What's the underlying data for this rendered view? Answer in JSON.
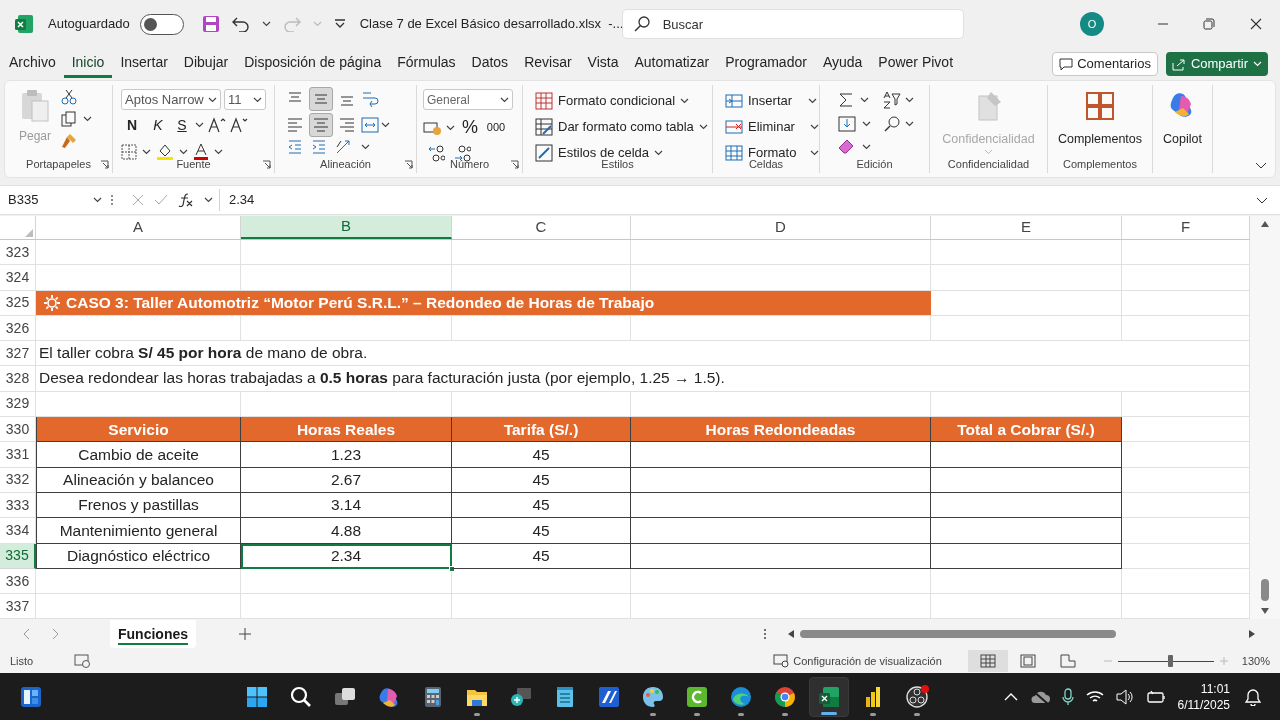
{
  "title_bar": {
    "autosave_label": "Autoguardado",
    "autosave_on": false,
    "filename": "Clase 7 de Excel Básico desarrollado.xlsx  -...",
    "search_placeholder": "Buscar",
    "avatar": "O"
  },
  "menu_tabs": [
    {
      "label": "Archivo",
      "selected": false
    },
    {
      "label": "Inicio",
      "selected": true
    },
    {
      "label": "Insertar",
      "selected": false
    },
    {
      "label": "Dibujar",
      "selected": false
    },
    {
      "label": "Disposición de página",
      "selected": false
    },
    {
      "label": "Fórmulas",
      "selected": false
    },
    {
      "label": "Datos",
      "selected": false
    },
    {
      "label": "Revisar",
      "selected": false
    },
    {
      "label": "Vista",
      "selected": false
    },
    {
      "label": "Automatizar",
      "selected": false
    },
    {
      "label": "Programador",
      "selected": false
    },
    {
      "label": "Ayuda",
      "selected": false
    },
    {
      "label": "Power Pivot",
      "selected": false
    }
  ],
  "comments_button": "Comentarios",
  "share_button": "Compartir",
  "ribbon_groups": [
    {
      "kind": "clipboard",
      "label": "Portapapeles",
      "paste": "Pegar",
      "launcher": true
    },
    {
      "kind": "font",
      "label": "Fuente",
      "font": "Aptos Narrow",
      "size": "11",
      "bold": "N",
      "italic": "K",
      "underline": "S",
      "launcher": true
    },
    {
      "kind": "alignment",
      "label": "Alineación",
      "launcher": true,
      "vertical": [
        {
          "selected": false
        },
        {
          "selected": true
        },
        {
          "selected": false
        }
      ],
      "horizontal": [
        {
          "selected": false
        },
        {
          "selected": true
        },
        {
          "selected": false
        }
      ]
    },
    {
      "kind": "number",
      "label": "Número",
      "format": "General",
      "percent": "%",
      "thousands": "000",
      "launcher": true
    },
    {
      "kind": "commands",
      "label": "Estilos",
      "launcher": false,
      "commands": [
        "Formato condicional",
        "Dar formato como tabla",
        "Estilos de celda"
      ]
    },
    {
      "kind": "commands",
      "label": "Celdas",
      "launcher": false,
      "commands": [
        "Insertar",
        "Eliminar",
        "Formato"
      ]
    },
    {
      "kind": "editing",
      "label": "Edición",
      "launcher": false
    },
    {
      "kind": "big",
      "label": "Confidencialidad",
      "button": "Confidencialidad",
      "disabled": true,
      "launcher": false
    },
    {
      "kind": "big",
      "label": "Complementos",
      "button": "Complementos",
      "disabled": false,
      "launcher": false
    },
    {
      "kind": "big",
      "button": "Copilot",
      "disabled": false,
      "launcher": false
    }
  ],
  "formula_bar": {
    "name_box": "B335",
    "formula": "2.34"
  },
  "columns": [
    {
      "label": "A",
      "selected": false
    },
    {
      "label": "B",
      "selected": true
    },
    {
      "label": "C",
      "selected": false
    },
    {
      "label": "D",
      "selected": false
    },
    {
      "label": "E",
      "selected": false
    },
    {
      "label": "F",
      "selected": false
    }
  ],
  "rows": [
    {
      "number": "323",
      "kind": "blank",
      "selected": false
    },
    {
      "number": "324",
      "kind": "blank",
      "selected": false
    },
    {
      "number": "325",
      "kind": "banner",
      "selected": false,
      "text": "CASO 3: Taller Automotriz “Motor Perú S.R.L.” – Redondeo de Horas de Trabajo"
    },
    {
      "number": "326",
      "kind": "blank",
      "selected": false
    },
    {
      "number": "327",
      "kind": "text",
      "selected": false,
      "text": "El taller cobra **S/ 45 por hora** de mano de obra."
    },
    {
      "number": "328",
      "kind": "text",
      "selected": false,
      "text": "Desea redondear las horas trabajadas a **0.5 horas** para facturación justa (por ejemplo, 1.25 → 1.5)."
    },
    {
      "number": "329",
      "kind": "blank",
      "selected": false
    },
    {
      "number": "330",
      "kind": "header",
      "selected": false,
      "cells": [
        "Servicio",
        "Horas Reales",
        "Tarifa (S/.)",
        "Horas Redondeadas",
        "Total a Cobrar (S/.)"
      ]
    },
    {
      "number": "331",
      "kind": "data",
      "selected": false,
      "cells": [
        "Cambio de aceite",
        "1.23",
        "45"
      ]
    },
    {
      "number": "332",
      "kind": "data",
      "selected": false,
      "cells": [
        "Alineación y balanceo",
        "2.67",
        "45"
      ]
    },
    {
      "number": "333",
      "kind": "data",
      "selected": false,
      "cells": [
        "Frenos y pastillas",
        "3.14",
        "45"
      ]
    },
    {
      "number": "334",
      "kind": "data",
      "selected": false,
      "cells": [
        "Mantenimiento general",
        "4.88",
        "45"
      ]
    },
    {
      "number": "335",
      "kind": "data",
      "selected": true,
      "cells": [
        "Diagnóstico eléctrico",
        "2.34",
        "45"
      ]
    },
    {
      "number": "336",
      "kind": "blank",
      "selected": false
    },
    {
      "number": "337",
      "kind": "blank",
      "selected": false
    }
  ],
  "sheet_tabs": [
    {
      "label": "Funciones",
      "selected": true
    }
  ],
  "status_bar": {
    "ready": "Listo",
    "display_settings": "Configuración de visualización",
    "views": [
      {
        "kind": "normal",
        "selected": true
      },
      {
        "kind": "page_layout",
        "selected": false
      },
      {
        "kind": "page_break",
        "selected": false
      }
    ],
    "zoom": {
      "level": 0.54,
      "reading": "130%"
    }
  },
  "taskbar": {
    "apps": [
      {
        "kind": "widgets",
        "selected": false,
        "running": false
      },
      {
        "kind": "start",
        "selected": false,
        "running": false
      },
      {
        "kind": "search",
        "selected": false,
        "running": false
      },
      {
        "kind": "taskview",
        "selected": false,
        "running": false
      },
      {
        "kind": "copilot",
        "selected": false,
        "running": false
      },
      {
        "kind": "calculator",
        "selected": false,
        "running": false
      },
      {
        "kind": "explorer",
        "selected": false,
        "running": true
      },
      {
        "kind": "magnifier",
        "selected": false,
        "running": false
      },
      {
        "kind": "notepad",
        "selected": false,
        "running": false
      },
      {
        "kind": "tile",
        "selected": false,
        "running": false
      },
      {
        "kind": "paint",
        "selected": false,
        "running": true
      },
      {
        "kind": "camtasia",
        "selected": false,
        "running": true
      },
      {
        "kind": "edge",
        "selected": false,
        "running": true
      },
      {
        "kind": "chrome",
        "selected": false,
        "running": true
      },
      {
        "kind": "excel",
        "selected": true,
        "running": true
      },
      {
        "kind": "powerbi",
        "selected": false,
        "running": true
      },
      {
        "kind": "obs",
        "selected": false,
        "running": true
      }
    ],
    "time": "11:01",
    "date": "6/11/2025"
  }
}
